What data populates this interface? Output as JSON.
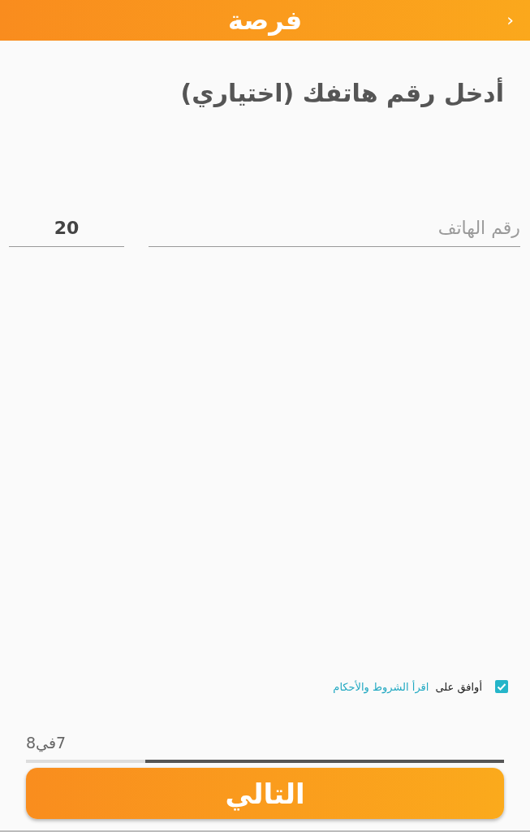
{
  "header": {
    "logo": "فرصة",
    "back": "‹"
  },
  "title": "أدخل رقم هاتفك (اختياري)",
  "phone": {
    "country_code": "20",
    "placeholder": "رقم الهاتف"
  },
  "terms": {
    "checked": true,
    "label": "أوافق على",
    "link": "اقرأ الشروط والأحكام"
  },
  "progress": {
    "text": "7في8",
    "level": 0.75
  },
  "next_button": "التالي"
}
